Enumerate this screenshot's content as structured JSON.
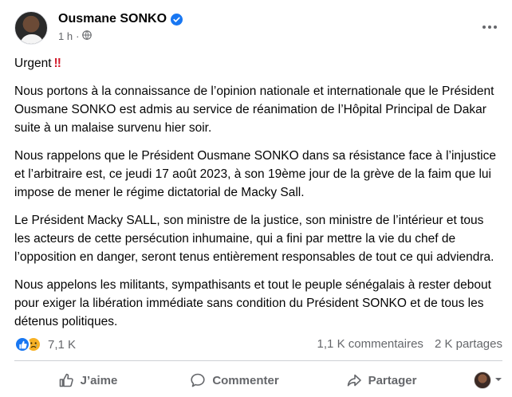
{
  "post": {
    "author": "Ousmane SONKO",
    "time": "1 h",
    "urgent_label": "Urgent",
    "urgent_marks": "!!",
    "paragraphs": [
      "Nous portons à la connaissance de l’opinion nationale et internationale que le Président Ousmane SONKO est admis au service de réanimation de l’Hôpital Principal de Dakar suite à un malaise survenu hier soir.",
      "Nous rappelons que le Président Ousmane SONKO dans sa résistance face à l’injustice et l’arbitraire est, ce jeudi 17 août 2023, à son 19ème jour de la grève de la faim que lui impose de mener le régime dictatorial de Macky Sall.",
      "Le Président Macky SALL, son ministre de la justice, son ministre de l’intérieur et tous les acteurs de cette persécution inhumaine, qui a fini par mettre la vie du chef de l’opposition en danger, seront tenus entièrement responsables de tout ce qui adviendra.",
      "Nous appelons les militants, sympathisants et tout le peuple sénégalais à rester debout pour exiger la libération immédiate sans condition du Président SONKO et de tous les détenus politiques."
    ]
  },
  "stats": {
    "reactions_count": "7,1 K",
    "comments": "1,1 K commentaires",
    "shares": "2 K partages"
  },
  "actions": {
    "like": "J’aime",
    "comment": "Commenter",
    "share": "Partager"
  },
  "colors": {
    "like_blue": "#1877f2",
    "text_secondary": "#65676b",
    "verified_blue": "#1877f2",
    "urgent_red": "#d11a2a"
  }
}
